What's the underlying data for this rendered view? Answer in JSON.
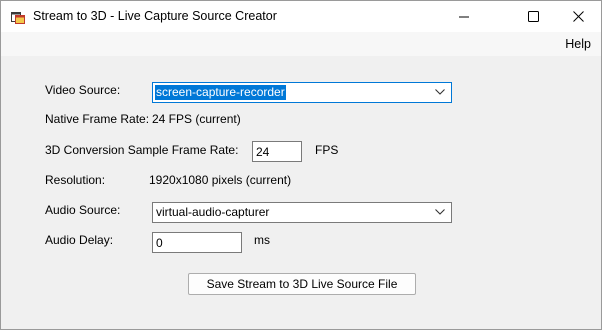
{
  "window": {
    "title": "Stream to 3D - Live Capture Source Creator",
    "icons": {
      "app": "app-icon",
      "minimize": "minimize-icon",
      "maximize": "maximize-icon",
      "close": "close-icon"
    }
  },
  "menu": {
    "help": "Help"
  },
  "form": {
    "video_source_label": "Video Source:",
    "video_source_value": "screen-capture-recorder",
    "native_frame_rate_label": "Native Frame Rate:",
    "native_frame_rate_value": "24 FPS (current)",
    "sample_rate_label": "3D Conversion Sample Frame Rate:",
    "sample_rate_value": "24",
    "sample_rate_unit": "FPS",
    "resolution_label": "Resolution:",
    "resolution_value": "1920x1080 pixels (current)",
    "audio_source_label": "Audio Source:",
    "audio_source_value": "virtual-audio-capturer",
    "audio_delay_label": "Audio Delay:",
    "audio_delay_value": "0",
    "audio_delay_unit": "ms",
    "save_button": "Save Stream to 3D Live Source File"
  },
  "colors": {
    "accent": "#0078d7",
    "window_bg": "#f0f0f0",
    "titlebar_bg": "#ffffff"
  }
}
